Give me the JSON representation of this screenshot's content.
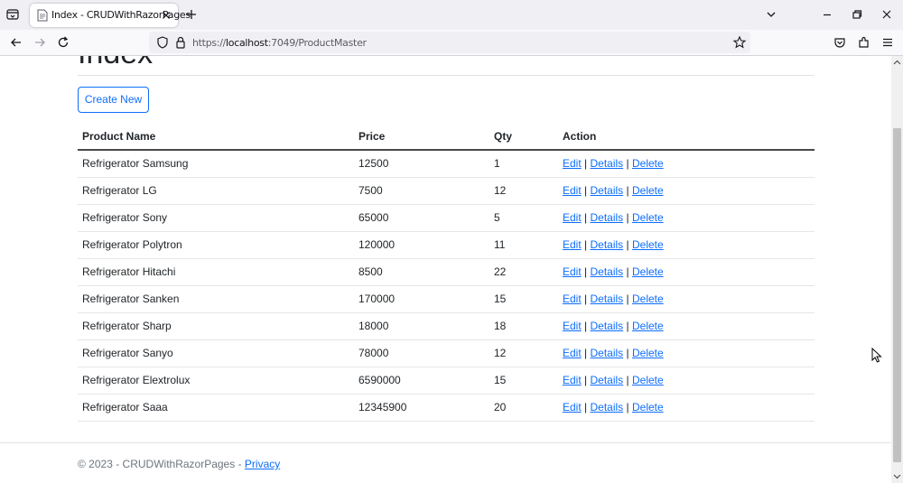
{
  "browser": {
    "tab_title": "Index - CRUDWithRazorPages",
    "url_prefix": "https://",
    "url_host": "localhost",
    "url_rest": ":7049/ProductMaster"
  },
  "page": {
    "heading": "Index",
    "create_label": "Create New",
    "columns": [
      "Product Name",
      "Price",
      "Qty",
      "Action"
    ],
    "rows": [
      {
        "name": "Refrigerator Samsung",
        "price": "12500",
        "qty": "1"
      },
      {
        "name": "Refrigerator LG",
        "price": "7500",
        "qty": "12"
      },
      {
        "name": "Refrigerator Sony",
        "price": "65000",
        "qty": "5"
      },
      {
        "name": "Refrigerator Polytron",
        "price": "120000",
        "qty": "11"
      },
      {
        "name": "Refrigerator Hitachi",
        "price": "8500",
        "qty": "22"
      },
      {
        "name": "Refrigerator Sanken",
        "price": "170000",
        "qty": "15"
      },
      {
        "name": "Refrigerator Sharp",
        "price": "18000",
        "qty": "18"
      },
      {
        "name": "Refrigerator Sanyo",
        "price": "78000",
        "qty": "12"
      },
      {
        "name": "Refrigerator Elextrolux",
        "price": "6590000",
        "qty": "15"
      },
      {
        "name": "Refrigerator Saaa",
        "price": "12345900",
        "qty": "20"
      }
    ],
    "actions": {
      "edit": "Edit",
      "details": "Details",
      "delete": "Delete",
      "separator": "|"
    }
  },
  "footer": {
    "text": "© 2023 - CRUDWithRazorPages - ",
    "privacy_label": "Privacy"
  },
  "colors": {
    "accent": "#0d6efd",
    "chrome": "#f0f0f4"
  }
}
